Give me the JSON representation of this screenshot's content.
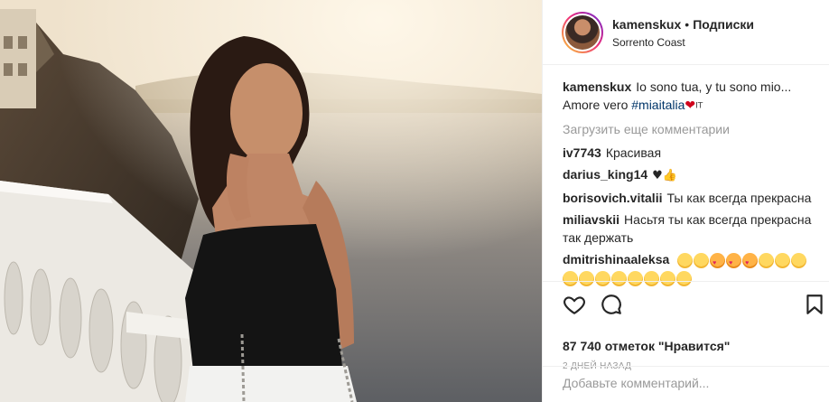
{
  "header": {
    "username": "kamenskux",
    "separator": "•",
    "follow_label": "Подписки",
    "location": "Sorrento Coast"
  },
  "caption": {
    "username": "kamenskux",
    "text": "Io sono tua, y tu sono mio... Amore vero ",
    "hashtag": "#miaitalia",
    "heart": "❤",
    "suffix": "IT"
  },
  "load_more": "Загрузить еще комментарии",
  "comments": [
    {
      "username": "iv7743",
      "text": "Красивая"
    },
    {
      "username": "darius_king14",
      "text": "♥👍"
    },
    {
      "username": "borisovich.vitalii",
      "text": "Ты как всегда прекрасна"
    },
    {
      "username": "miliavskii",
      "text": "Насьтя ты как всегда прекрасна так держать"
    },
    {
      "username": "dmitrishinaaleksa",
      "text": ""
    }
  ],
  "actions": {
    "like_icon": "heart-outline-icon",
    "comment_icon": "comment-bubble-icon",
    "save_icon": "bookmark-icon"
  },
  "likes": "87 740 отметок \"Нравится\"",
  "time_ago": "2 ДНЕЙ НАЗАД",
  "add_comment": {
    "placeholder": "Добавьте комментарий..."
  },
  "colors": {
    "link": "#003569",
    "muted": "#999999",
    "text": "#262626",
    "heart": "#d0021b"
  }
}
